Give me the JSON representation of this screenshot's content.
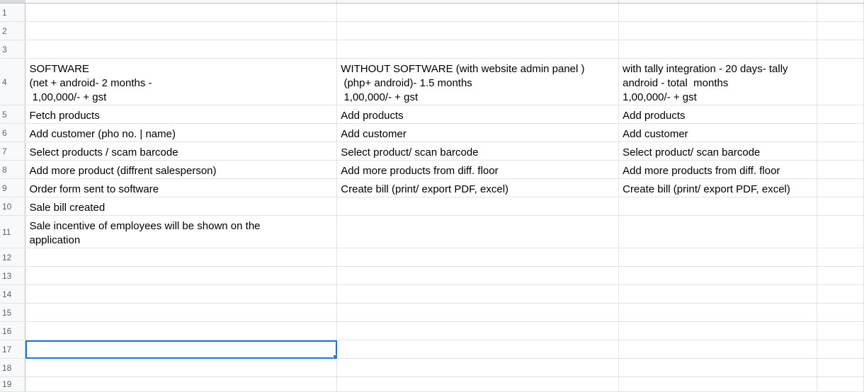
{
  "rows": [
    {
      "num": "1",
      "cells": [
        "",
        "",
        ""
      ]
    },
    {
      "num": "2",
      "cells": [
        "",
        "",
        ""
      ]
    },
    {
      "num": "3",
      "cells": [
        "",
        "",
        ""
      ]
    },
    {
      "num": "4",
      "cells": [
        "SOFTWARE\n(net + android- 2 months -\n 1,00,000/- + gst",
        "WITHOUT SOFTWARE (with website admin panel )\n (php+ android)- 1.5 months\n 1,00,000/- + gst",
        "with tally integration - 20 days- tally\nandroid - total  months\n1,00,000/- + gst"
      ]
    },
    {
      "num": "5",
      "cells": [
        "Fetch products",
        "Add products",
        "Add products"
      ]
    },
    {
      "num": "6",
      "cells": [
        "Add customer (pho no. | name)",
        "Add customer",
        "Add customer"
      ]
    },
    {
      "num": "7",
      "cells": [
        "Select products / scam barcode",
        "Select product/ scan barcode",
        "Select product/ scan barcode"
      ]
    },
    {
      "num": "8",
      "cells": [
        "Add more product (diffrent salesperson)",
        "Add more products from diff. floor",
        "Add more products from diff. floor"
      ]
    },
    {
      "num": "9",
      "cells": [
        "Order form sent to software",
        "Create bill (print/ export PDF, excel)",
        "Create bill (print/ export PDF, excel)"
      ]
    },
    {
      "num": "10",
      "cells": [
        "Sale bill created",
        "",
        ""
      ]
    },
    {
      "num": "11",
      "cells": [
        "Sale incentive of employees will be shown on the\napplication",
        "",
        ""
      ]
    },
    {
      "num": "12",
      "cells": [
        "",
        "",
        ""
      ]
    },
    {
      "num": "13",
      "cells": [
        "",
        "",
        ""
      ]
    },
    {
      "num": "14",
      "cells": [
        "",
        "",
        ""
      ]
    },
    {
      "num": "15",
      "cells": [
        "",
        "",
        ""
      ]
    },
    {
      "num": "16",
      "cells": [
        "",
        "",
        ""
      ]
    },
    {
      "num": "17",
      "cells": [
        "",
        "",
        ""
      ]
    },
    {
      "num": "18",
      "cells": [
        "",
        "",
        ""
      ]
    },
    {
      "num": "19",
      "cells": [
        "",
        "",
        ""
      ]
    }
  ],
  "selected_row": "17",
  "colors": {
    "selection": "#1a73e8",
    "gridline": "#e2e3e3",
    "header_bg": "#f8f9fa"
  }
}
